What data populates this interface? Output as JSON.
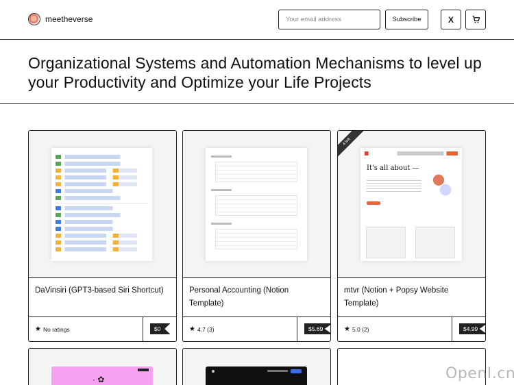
{
  "header": {
    "brand_name": "meetheverse",
    "email_placeholder": "Your email address",
    "subscribe_label": "Subscribe",
    "x_icon": "X",
    "cart_icon": "🛒"
  },
  "hero": {
    "title": "Organizational Systems and Automation Mechanisms to level up your Productivity and Optimize your Life Projects"
  },
  "products": [
    {
      "title": "DaVinsiri (GPT3-based Siri Shortcut)",
      "rating": "No ratings",
      "price": "$0"
    },
    {
      "title": "Personal Accounting (Notion Template)",
      "rating": "4.7 (3)",
      "price": "$5.69"
    },
    {
      "title": "mtvr (Notion + Popsy Website Template)",
      "rating": "5.0 (2)",
      "price": "$4.99",
      "ribbon": "4 left",
      "thumb_heading": "It's all about —"
    }
  ],
  "watermark": "OpenI.cn",
  "colors": {
    "border": "#222222",
    "price_tag": "#222222",
    "pink_thumb": "#f7a2f0",
    "dark_thumb": "#0f0f10"
  }
}
